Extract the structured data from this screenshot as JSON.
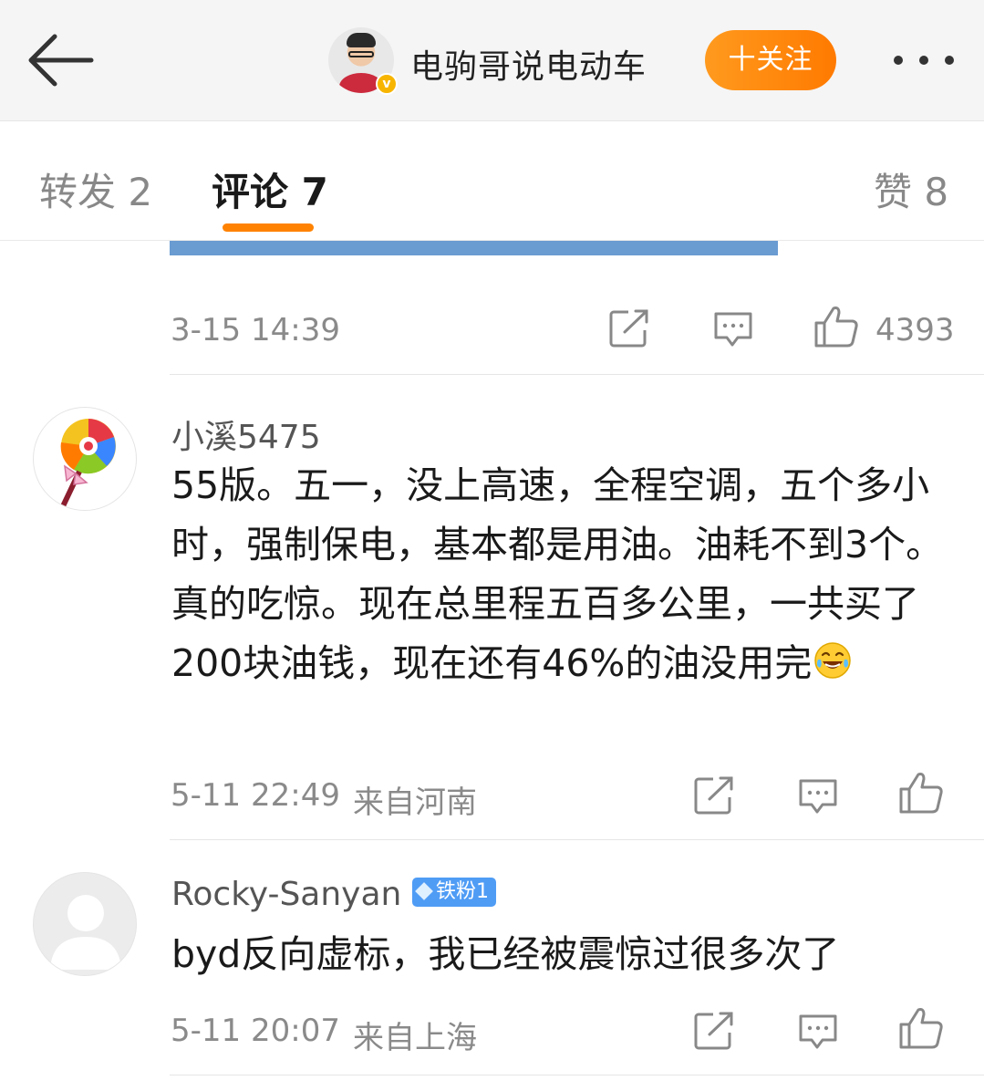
{
  "header": {
    "author_name": "电驹哥说电动车",
    "follow_label": "十关注",
    "verified_badge": "v"
  },
  "tabs": {
    "repost": "转发 2",
    "comments": "评论 7",
    "likes": "赞 8",
    "active": "comments",
    "accent_color": "#ff8200"
  },
  "post_footer": {
    "timestamp": "3-15 14:39",
    "like_count": "4393"
  },
  "comments": [
    {
      "username": "小溪5475",
      "avatar_icon": "lollipop-avatar",
      "text": "55版。五一，没上高速，全程空调，五个多小时，强制保电，基本都是用油。油耗不到3个。真的吃惊。现在总里程五百多公里，一共买了200块油钱，现在还有46%的油没用完",
      "emoji": "laughing-tears-emoji",
      "timestamp": "5-11 22:49",
      "location": "来自河南"
    },
    {
      "username": "Rocky-Sanyan",
      "badge": "铁粉1",
      "avatar_icon": "default-user-avatar",
      "text": "byd反向虚标，我已经被震惊过很多次了",
      "timestamp": "5-11 20:07",
      "location": "来自上海"
    }
  ]
}
